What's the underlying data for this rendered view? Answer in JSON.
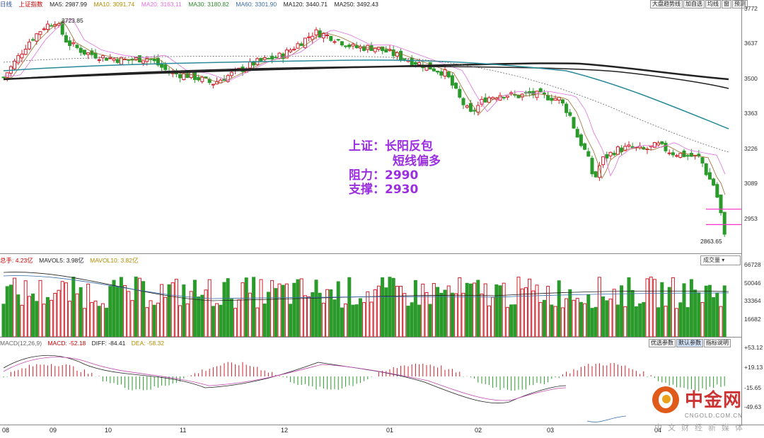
{
  "header": {
    "period": "日线",
    "index_name": "上证指数",
    "ma": [
      {
        "label": "MA5: 2987.99",
        "color": "#222222"
      },
      {
        "label": "MA10: 3091.74",
        "color": "#c8a000"
      },
      {
        "label": "MA20: 3163.11",
        "color": "#e070e0"
      },
      {
        "label": "MA30: 3180.82",
        "color": "#2a8a2a"
      },
      {
        "label": "MA60: 3301.90",
        "color": "#3a6ea8"
      },
      {
        "label": "MA120: 3440.71",
        "color": "#222222"
      },
      {
        "label": "MA250: 3492.43",
        "color": "#222222"
      }
    ],
    "buttons": [
      "大盘趋势线",
      "加自选",
      "均线",
      "窗",
      "预测"
    ]
  },
  "price_axis": [
    "3772",
    "3637",
    "3500",
    "3363",
    "3226",
    "3089",
    "2953"
  ],
  "price_labels": {
    "high": "3723.85",
    "low": "2863.65"
  },
  "volume": {
    "info": [
      "总手: 4.23亿",
      "MAVOL5: 3.98亿",
      "MAVOL10: 3.82亿"
    ],
    "axis": [
      "66728",
      "50046",
      "33364",
      "16682"
    ],
    "dropdown": "成交量"
  },
  "macd": {
    "info": [
      "MACD(12,26,9)",
      "MACD: -52.18",
      "DIFF: -84.41",
      "DEA: -58.32"
    ],
    "axis": [
      "+53.12",
      "+19.13",
      "-15.65",
      "-49.63"
    ],
    "tabs": [
      "优选参数",
      "默认参数",
      "指标说明"
    ]
  },
  "months": [
    "08",
    "09",
    "10",
    "11",
    "12",
    "01",
    "02",
    "03",
    "04"
  ],
  "annotation": {
    "line1": "上证：长阳反包",
    "line2": "短线偏多",
    "line3": "阻力：2990",
    "line4": "支撑：2930"
  },
  "watermark": {
    "name": "中金网",
    "url": "CNGOLD.COM.CN",
    "sub": "中文财经新媒体"
  },
  "colors": {
    "up": "#d0202a",
    "down": "#2a9a2a",
    "annotation": "#9b2fe0",
    "resistance": "#ff33cc"
  },
  "chart_data": {
    "type": "candlestick",
    "x_range": [
      "08",
      "04"
    ],
    "price_range": [
      2863.65,
      3772
    ],
    "key_levels": {
      "resistance": 2990,
      "support": 2930
    },
    "marked_high": 3723.85,
    "marked_low": 2863.65
  }
}
